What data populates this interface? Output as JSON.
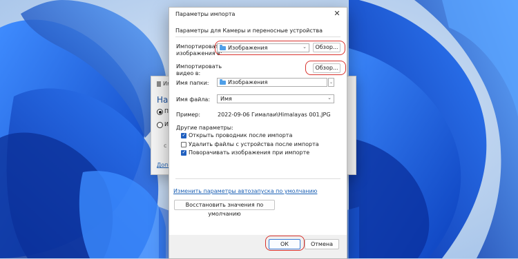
{
  "colors": {
    "accent": "#1f5fbf",
    "link": "#1a5fb4",
    "highlight": "#d8312c"
  },
  "background_window": {
    "title": "Им",
    "heading": "Най",
    "radio_1": "П",
    "radio_2": "И",
    "dot": "с",
    "link": "Допо"
  },
  "dialog": {
    "title": "Параметры импорта",
    "close_icon": "close-icon",
    "section_title": "Параметры для Камеры и переносные устройства",
    "import_images_label": "Импортировать\nизображения в:",
    "import_images_value": "Изображения",
    "browse_label": "Обзор...",
    "import_video_label": "Импортировать\nвидео в:",
    "video_browse_label": "Обзор...",
    "folder_name_label": "Имя папки:",
    "folder_name_value": "Изображения",
    "file_name_label": "Имя файла:",
    "file_name_value": "Имя",
    "example_label": "Пример:",
    "example_value": "2022-09-06 Гималаи\\Himalayas 001.JPG",
    "other_params_label": "Другие параметры:",
    "options": [
      {
        "label": "Открыть проводник после импорта",
        "checked": true
      },
      {
        "label": "Удалить файлы с устройства после импорта",
        "checked": false
      },
      {
        "label": "Поворачивать изображения при импорте",
        "checked": true
      }
    ],
    "autoplay_link": "Изменить параметры автозапуска по умолчанию",
    "restore_defaults": "Восстановить значения по умолчанию",
    "ok_label": "ОК",
    "cancel_label": "Отмена"
  }
}
